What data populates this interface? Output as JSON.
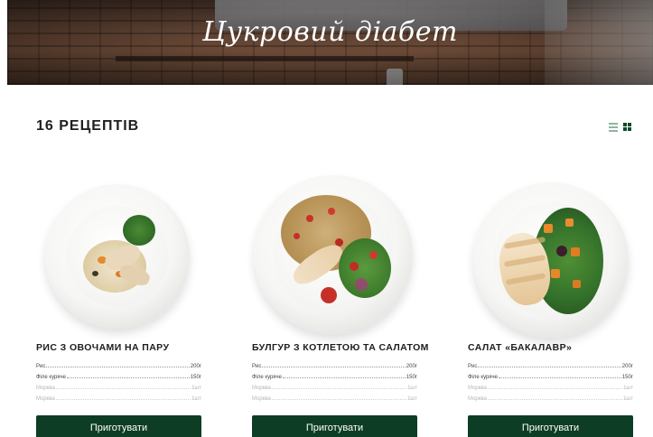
{
  "hero": {
    "title": "Цукровий діабет"
  },
  "listing": {
    "count_title": "16 РЕЦЕПТІВ",
    "view_modes": [
      "list",
      "grid"
    ],
    "active_view": "grid"
  },
  "colors": {
    "accent": "#0d3d24",
    "toggle_inactive": "#8fb59e"
  },
  "recipes": [
    {
      "title": "РИС З ОВОЧАМИ НА ПАРУ",
      "ingredients": [
        {
          "name": "Рис",
          "qty": "200г"
        },
        {
          "name": "Філе куряче",
          "qty": "150г"
        },
        {
          "name": "Морква",
          "qty": "1шт"
        },
        {
          "name": "Морква",
          "qty": "1шт"
        }
      ],
      "button": "Приготувати"
    },
    {
      "title": "БУЛГУР З КОТЛЕТОЮ ТА САЛАТОМ",
      "ingredients": [
        {
          "name": "Рис",
          "qty": "200г"
        },
        {
          "name": "Філе куряче",
          "qty": "150г"
        },
        {
          "name": "Морква",
          "qty": "1шт"
        },
        {
          "name": "Морква",
          "qty": "1шт"
        }
      ],
      "button": "Приготувати"
    },
    {
      "title": "САЛАТ «БАКАЛАВР»",
      "ingredients": [
        {
          "name": "Рис",
          "qty": "200г"
        },
        {
          "name": "Філе куряче",
          "qty": "150г"
        },
        {
          "name": "Морква",
          "qty": "1шт"
        },
        {
          "name": "Морква",
          "qty": "1шт"
        }
      ],
      "button": "Приготувати"
    }
  ]
}
